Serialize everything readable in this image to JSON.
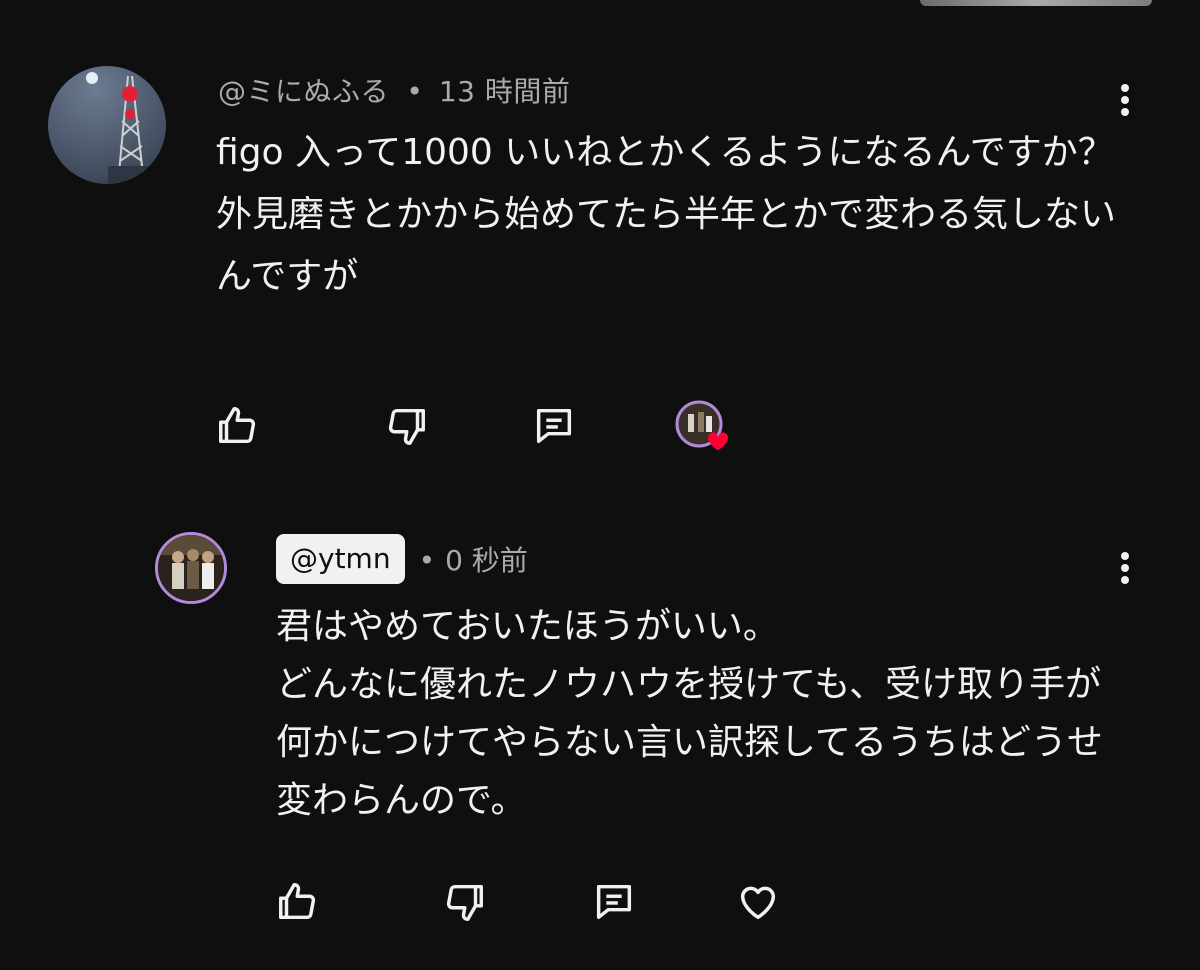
{
  "comment": {
    "author": "@ミにぬふる",
    "separator": "•",
    "time": "13 時間前",
    "text": "figo 入って1000 いいねとかくるようになるんですか？\n外見磨きとかから始めてたら半年とかで変わる気しないんですが"
  },
  "reply": {
    "author": "@ytmn",
    "separator": "•",
    "time": "0 秒前",
    "text": "君はやめておいたほうがいい。\nどんなに優れたノウハウを授けても、受け取り手が何かにつけてやらない言い訳探してるうちはどうせ変わらんので。"
  },
  "icons": {
    "like": "thumbs-up-icon",
    "dislike": "thumbs-down-icon",
    "reply": "comment-icon",
    "creator_heart": "creator-heart-icon",
    "heart": "heart-icon",
    "more": "more-vert-icon"
  },
  "colors": {
    "background": "#0f0f0f",
    "text": "#f1f1f1",
    "meta": "#aaaaaa",
    "heart_red": "#ff0033"
  }
}
